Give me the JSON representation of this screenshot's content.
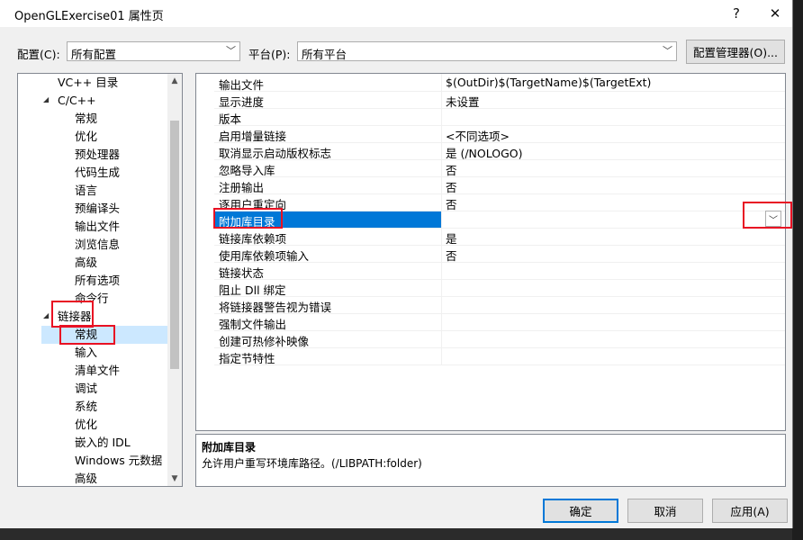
{
  "window": {
    "title": "OpenGLExercise01 属性页",
    "help_glyph": "?",
    "close_glyph": "✕"
  },
  "config_row": {
    "config_label": "配置(C):",
    "config_value": "所有配置",
    "platform_label": "平台(P):",
    "platform_value": "所有平台",
    "manager_button": "配置管理器(O)..."
  },
  "tree": {
    "items": [
      {
        "label": "VC++ 目录",
        "level": 1
      },
      {
        "label": "C/C++",
        "level": 1,
        "expanded": true
      },
      {
        "label": "常规",
        "level": 2
      },
      {
        "label": "优化",
        "level": 2
      },
      {
        "label": "预处理器",
        "level": 2
      },
      {
        "label": "代码生成",
        "level": 2
      },
      {
        "label": "语言",
        "level": 2
      },
      {
        "label": "预编译头",
        "level": 2
      },
      {
        "label": "输出文件",
        "level": 2
      },
      {
        "label": "浏览信息",
        "level": 2
      },
      {
        "label": "高级",
        "level": 2
      },
      {
        "label": "所有选项",
        "level": 2
      },
      {
        "label": "命令行",
        "level": 2
      },
      {
        "label": "链接器",
        "level": 1,
        "expanded": true
      },
      {
        "label": "常规",
        "level": 2,
        "selected": true
      },
      {
        "label": "输入",
        "level": 2
      },
      {
        "label": "清单文件",
        "level": 2
      },
      {
        "label": "调试",
        "level": 2
      },
      {
        "label": "系统",
        "level": 2
      },
      {
        "label": "优化",
        "level": 2
      },
      {
        "label": "嵌入的 IDL",
        "level": 2
      },
      {
        "label": "Windows 元数据",
        "level": 2
      },
      {
        "label": "高级",
        "level": 2
      }
    ]
  },
  "properties": [
    {
      "name": "输出文件",
      "value": "$(OutDir)$(TargetName)$(TargetExt)"
    },
    {
      "name": "显示进度",
      "value": "未设置"
    },
    {
      "name": "版本",
      "value": ""
    },
    {
      "name": "启用增量链接",
      "value": "<不同选项>"
    },
    {
      "name": "取消显示启动版权标志",
      "value": "是 (/NOLOGO)"
    },
    {
      "name": "忽略导入库",
      "value": "否"
    },
    {
      "name": "注册输出",
      "value": "否"
    },
    {
      "name": "逐用户重定向",
      "value": "否"
    },
    {
      "name": "附加库目录",
      "value": "",
      "selected": true
    },
    {
      "name": "链接库依赖项",
      "value": "是"
    },
    {
      "name": "使用库依赖项输入",
      "value": "否"
    },
    {
      "name": "链接状态",
      "value": ""
    },
    {
      "name": "阻止 Dll 绑定",
      "value": ""
    },
    {
      "name": "将链接器警告视为错误",
      "value": ""
    },
    {
      "name": "强制文件输出",
      "value": ""
    },
    {
      "name": "创建可热修补映像",
      "value": ""
    },
    {
      "name": "指定节特性",
      "value": ""
    }
  ],
  "description": {
    "title": "附加库目录",
    "text": "允许用户重写环境库路径。(/LIBPATH:folder)"
  },
  "buttons": {
    "ok": "确定",
    "cancel": "取消",
    "apply": "应用(A)"
  },
  "icons": {
    "dropdown": "chevron-down-icon",
    "expand": "triangle-down-icon",
    "scroll_up": "scroll-up-icon",
    "scroll_down": "scroll-down-icon"
  },
  "colors": {
    "selection": "#0078d7",
    "tree_selection": "#cce8ff",
    "annotation": "#e81123"
  }
}
